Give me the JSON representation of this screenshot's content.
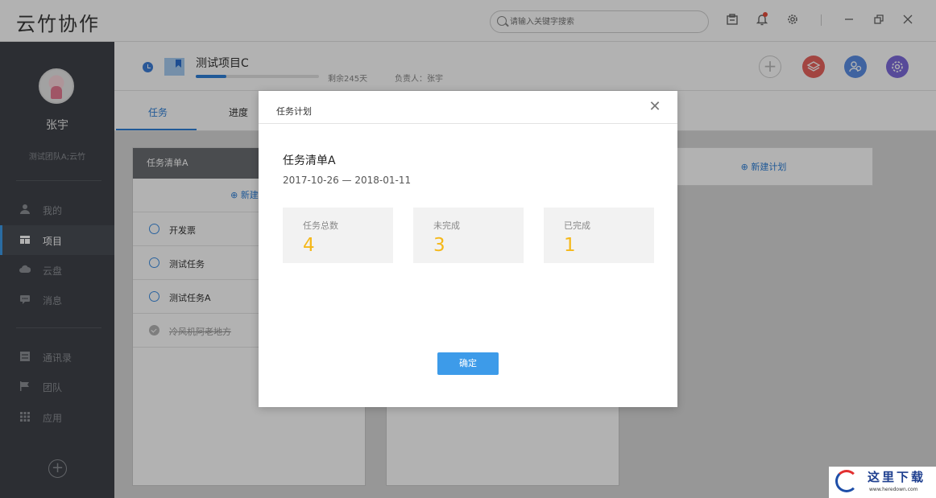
{
  "app": {
    "title": "云竹协作"
  },
  "search": {
    "placeholder": "请输入关键字搜索"
  },
  "user": {
    "name": "张宇",
    "team": "测试团队A;云竹"
  },
  "sidebar": {
    "items": [
      {
        "label": "我的",
        "icon": "user-icon"
      },
      {
        "label": "项目",
        "icon": "project-icon",
        "active": true
      },
      {
        "label": "云盘",
        "icon": "cloud-icon"
      },
      {
        "label": "消息",
        "icon": "message-icon"
      },
      {
        "label": "通讯录",
        "icon": "contacts-icon"
      },
      {
        "label": "团队",
        "icon": "flag-icon"
      },
      {
        "label": "应用",
        "icon": "apps-icon"
      }
    ]
  },
  "project": {
    "name": "测试项目C",
    "remaining": "剩余245天",
    "owner": "负责人：张宇",
    "progress": 0.25
  },
  "tabs": [
    {
      "label": "任务"
    },
    {
      "label": "进度"
    }
  ],
  "board": {
    "column_title": "任务清单A",
    "new_task": "⊕ 新建任",
    "new_plan": "⊕ 新建计划",
    "tasks": [
      {
        "label": "开发票",
        "done": false
      },
      {
        "label": "测试任务",
        "done": false
      },
      {
        "label": "测试任务A",
        "done": false
      },
      {
        "label": "冷风机阿老地方",
        "done": true
      }
    ]
  },
  "modal": {
    "title": "任务计划",
    "list_name": "任务清单A",
    "date_range": "2017-10-26 — 2018-01-11",
    "stats": [
      {
        "label": "任务总数",
        "value": "4"
      },
      {
        "label": "未完成",
        "value": "3"
      },
      {
        "label": "已完成",
        "value": "1"
      }
    ],
    "confirm": "确定"
  },
  "watermark": {
    "text": "这里下载",
    "url": "www.heredown.com"
  },
  "colors": {
    "accent": "#3d9be9",
    "stat_value": "#f5b819",
    "sidebar_bg": "#3f4349"
  }
}
